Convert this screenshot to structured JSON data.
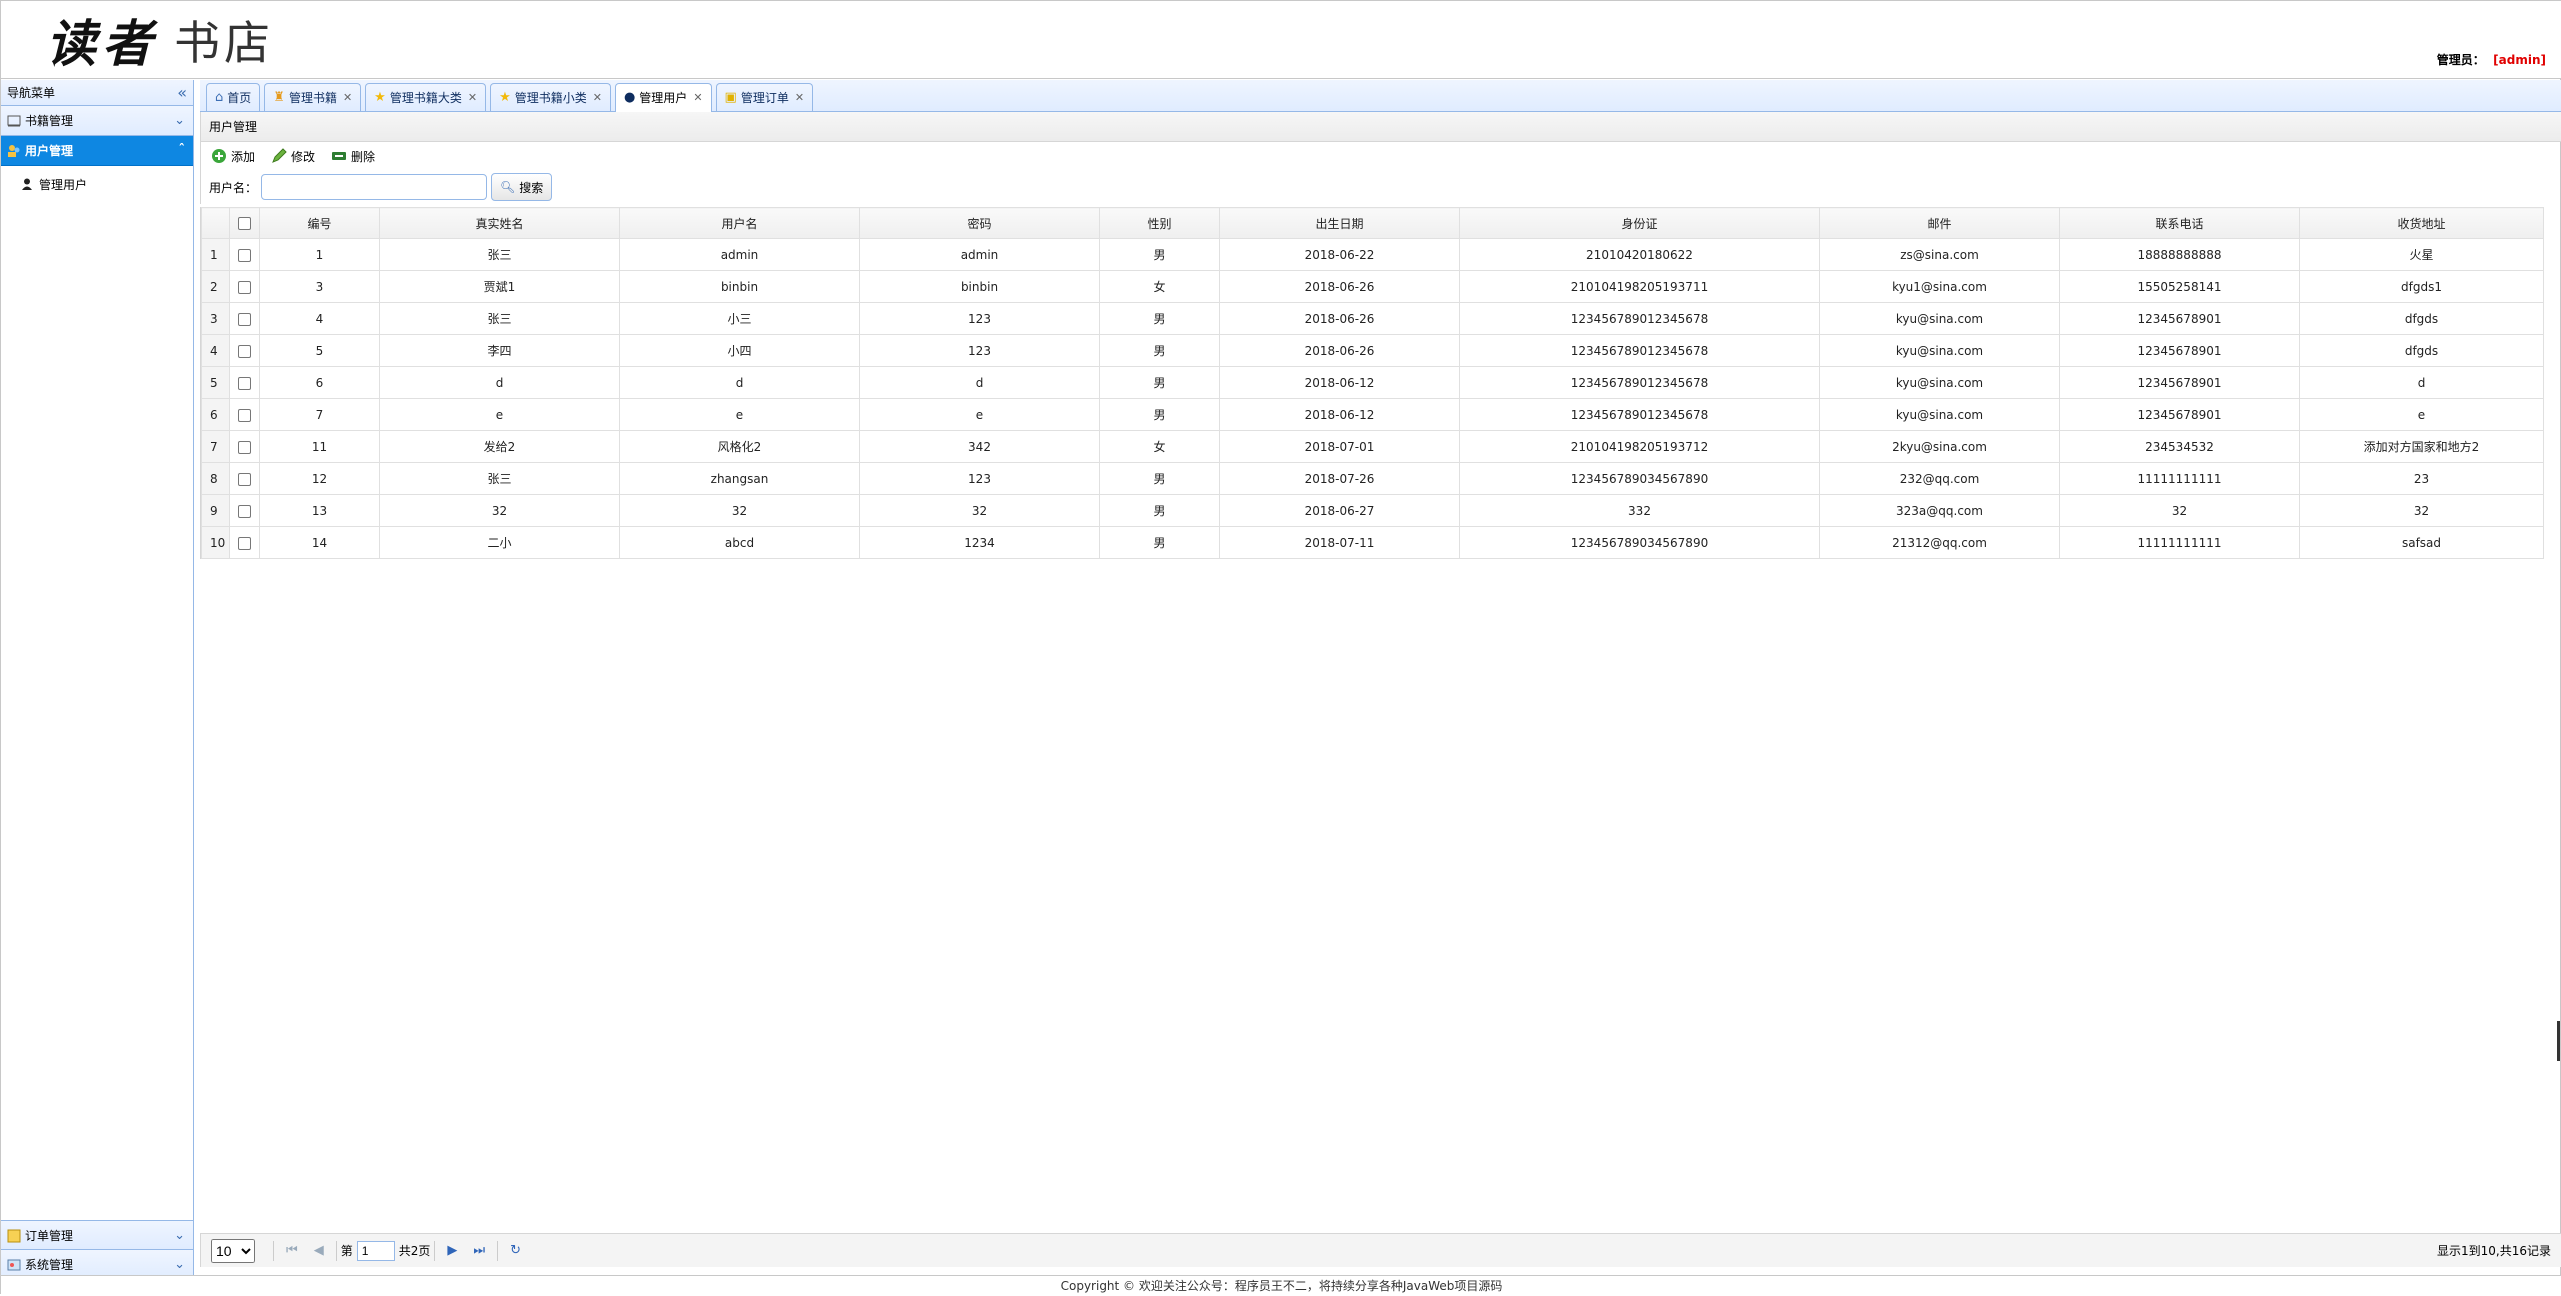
{
  "header": {
    "logo_main": "读者",
    "logo_sub": "书店",
    "admin_label": "管理员：",
    "admin_name": "[admin]"
  },
  "nav": {
    "title": "导航菜单",
    "collapse_icon": "double-chevron-left-icon",
    "sections": [
      {
        "label": "书籍管理",
        "icon": "book-icon"
      },
      {
        "label": "用户管理",
        "icon": "users-icon",
        "selected": true,
        "items": [
          "管理用户"
        ]
      },
      {
        "label": "订单管理",
        "icon": "order-icon"
      },
      {
        "label": "系统管理",
        "icon": "system-icon"
      }
    ]
  },
  "tabs": [
    {
      "label": "首页",
      "icon": "home-icon",
      "closable": false
    },
    {
      "label": "管理书籍",
      "icon": "book-manage-icon",
      "closable": true
    },
    {
      "label": "管理书籍大类",
      "icon": "star-icon",
      "closable": true
    },
    {
      "label": "管理书籍小类",
      "icon": "star-icon",
      "closable": true
    },
    {
      "label": "管理用户",
      "icon": "user-icon",
      "closable": true,
      "selected": true
    },
    {
      "label": "管理订单",
      "icon": "order-icon",
      "closable": true
    }
  ],
  "panel": {
    "title": "用户管理"
  },
  "toolbar": {
    "add": "添加",
    "edit": "修改",
    "delete": "删除"
  },
  "search": {
    "label": "用户名：",
    "value": "",
    "button": "搜索"
  },
  "grid": {
    "columns": [
      "编号",
      "真实姓名",
      "用户名",
      "密码",
      "性别",
      "出生日期",
      "身份证",
      "邮件",
      "联系电话",
      "收货地址"
    ],
    "rows": [
      [
        "1",
        "张三",
        "admin",
        "admin",
        "男",
        "2018-06-22",
        "21010420180622",
        "zs@sina.com",
        "18888888888",
        "火星"
      ],
      [
        "3",
        "贾斌1",
        "binbin",
        "binbin",
        "女",
        "2018-06-26",
        "210104198205193711",
        "kyu1@sina.com",
        "15505258141",
        "dfgds1"
      ],
      [
        "4",
        "张三",
        "小三",
        "123",
        "男",
        "2018-06-26",
        "123456789012345678",
        "kyu@sina.com",
        "12345678901",
        "dfgds"
      ],
      [
        "5",
        "李四",
        "小四",
        "123",
        "男",
        "2018-06-26",
        "123456789012345678",
        "kyu@sina.com",
        "12345678901",
        "dfgds"
      ],
      [
        "6",
        "d",
        "d",
        "d",
        "男",
        "2018-06-12",
        "123456789012345678",
        "kyu@sina.com",
        "12345678901",
        "d"
      ],
      [
        "7",
        "e",
        "e",
        "e",
        "男",
        "2018-06-12",
        "123456789012345678",
        "kyu@sina.com",
        "12345678901",
        "e"
      ],
      [
        "11",
        "发给2",
        "风格化2",
        "342",
        "女",
        "2018-07-01",
        "210104198205193712",
        "2kyu@sina.com",
        "234534532",
        "添加对方国家和地方2"
      ],
      [
        "12",
        "张三",
        "zhangsan",
        "123",
        "男",
        "2018-07-26",
        "123456789034567890",
        "232@qq.com",
        "11111111111",
        "23"
      ],
      [
        "13",
        "32",
        "32",
        "32",
        "男",
        "2018-06-27",
        "332",
        "323a@qq.com",
        "32",
        "32"
      ],
      [
        "14",
        "二小",
        "abcd",
        "1234",
        "男",
        "2018-07-11",
        "123456789034567890",
        "21312@qq.com",
        "11111111111",
        "safsad"
      ]
    ]
  },
  "pager": {
    "page_size": "10",
    "page_prefix": "第",
    "page_value": "1",
    "page_suffix": "共2页",
    "info": "显示1到10,共16记录"
  },
  "footer": {
    "text": "Copyright © 欢迎关注公众号：程序员王不二，将持续分享各种JavaWeb项目源码"
  }
}
